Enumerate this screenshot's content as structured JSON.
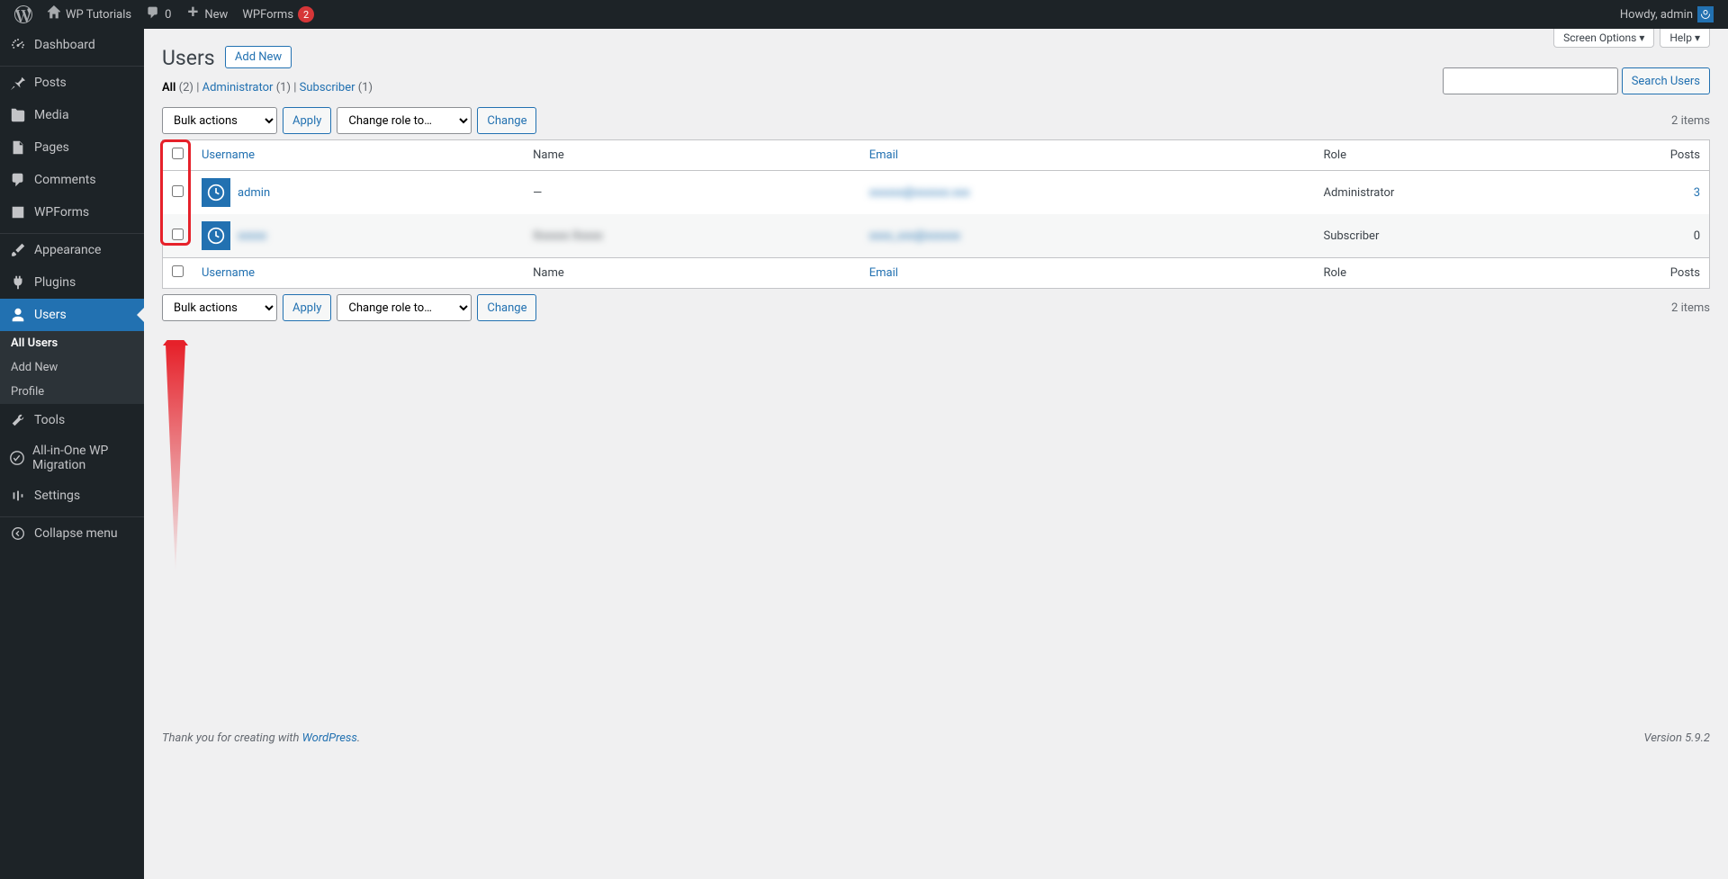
{
  "adminbar": {
    "site_name": "WP Tutorials",
    "comments_count": "0",
    "new_label": "New",
    "wpforms_label": "WPForms",
    "wpforms_badge": "2",
    "howdy": "Howdy, admin"
  },
  "sidebar": {
    "items": [
      {
        "label": "Dashboard"
      },
      {
        "label": "Posts"
      },
      {
        "label": "Media"
      },
      {
        "label": "Pages"
      },
      {
        "label": "Comments"
      },
      {
        "label": "WPForms"
      },
      {
        "label": "Appearance"
      },
      {
        "label": "Plugins"
      },
      {
        "label": "Users"
      },
      {
        "label": "Tools"
      },
      {
        "label": "All-in-One WP Migration"
      },
      {
        "label": "Settings"
      },
      {
        "label": "Collapse menu"
      }
    ],
    "submenu": [
      {
        "label": "All Users"
      },
      {
        "label": "Add New"
      },
      {
        "label": "Profile"
      }
    ]
  },
  "page": {
    "title": "Users",
    "add_new": "Add New",
    "screen_options": "Screen Options",
    "help": "Help"
  },
  "filters": {
    "all_label": "All",
    "all_count": "(2)",
    "admin_label": "Administrator",
    "admin_count": "(1)",
    "sub_label": "Subscriber",
    "sub_count": "(1)"
  },
  "search": {
    "button": "Search Users"
  },
  "actions": {
    "bulk": "Bulk actions",
    "apply": "Apply",
    "change_role": "Change role to…",
    "change": "Change"
  },
  "paging": {
    "count": "2 items"
  },
  "columns": {
    "username": "Username",
    "name": "Name",
    "email": "Email",
    "role": "Role",
    "posts": "Posts"
  },
  "rows": [
    {
      "username": "admin",
      "name": "—",
      "email": "xxxxxx@xxxxxx.xxx",
      "role": "Administrator",
      "posts": "3",
      "blur": false
    },
    {
      "username": "xxxxx",
      "name": "Xxxxxx Xxxxx",
      "email": "xxxx_xxx@xxxxxx",
      "role": "Subscriber",
      "posts": "0",
      "blur": true
    }
  ],
  "footer": {
    "thanks": "Thank you for creating with ",
    "wp": "WordPress",
    "dot": ".",
    "version": "Version 5.9.2"
  }
}
